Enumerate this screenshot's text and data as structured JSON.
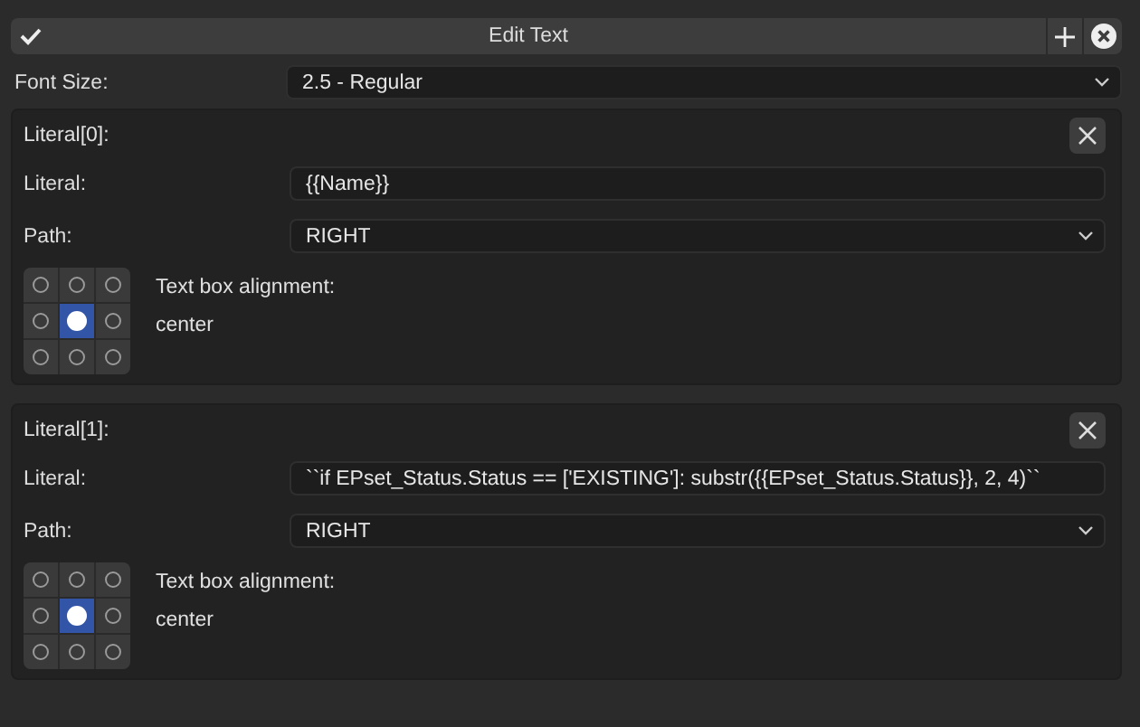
{
  "header": {
    "title": "Edit Text"
  },
  "font_size": {
    "label": "Font Size:",
    "value": "2.5 - Regular"
  },
  "literals": [
    {
      "title": "Literal[0]:",
      "literal_label": "Literal:",
      "literal_value": "{{Name}}",
      "path_label": "Path:",
      "path_value": "RIGHT",
      "alignment_label": "Text box alignment:",
      "alignment_value": "center",
      "alignment_cells": [
        {
          "selected": false
        },
        {
          "selected": false
        },
        {
          "selected": false
        },
        {
          "selected": false
        },
        {
          "selected": true
        },
        {
          "selected": false
        },
        {
          "selected": false
        },
        {
          "selected": false
        },
        {
          "selected": false
        }
      ]
    },
    {
      "title": "Literal[1]:",
      "literal_label": "Literal:",
      "literal_value": "``if EPset_Status.Status == ['EXISTING']:  substr({{EPset_Status.Status}}, 2, 4)``",
      "path_label": "Path:",
      "path_value": "RIGHT",
      "alignment_label": "Text box alignment:",
      "alignment_value": "center",
      "alignment_cells": [
        {
          "selected": false
        },
        {
          "selected": false
        },
        {
          "selected": false
        },
        {
          "selected": false
        },
        {
          "selected": true
        },
        {
          "selected": false
        },
        {
          "selected": false
        },
        {
          "selected": false
        },
        {
          "selected": false
        }
      ]
    }
  ]
}
